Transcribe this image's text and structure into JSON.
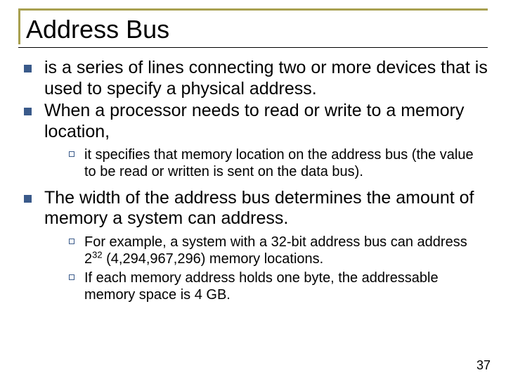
{
  "title": "Address Bus",
  "bullets": {
    "b1": "is a series of lines connecting two or more devices that is used to specify a physical address.",
    "b2": "When a processor needs to read or write to a memory location,",
    "b2_sub1": "it specifies that memory location on the address bus (the value to be read or written is sent on the data bus).",
    "b3": "The width of the address bus determines the amount of memory a system can address.",
    "b3_sub1_pre": "For example, a system with a 32-bit address bus can address 2",
    "b3_sub1_sup": "32",
    "b3_sub1_post": " (4,294,967,296) memory locations.",
    "b3_sub2": "If each memory address holds one byte, the addressable memory space is 4 GB."
  },
  "page_number": "37"
}
